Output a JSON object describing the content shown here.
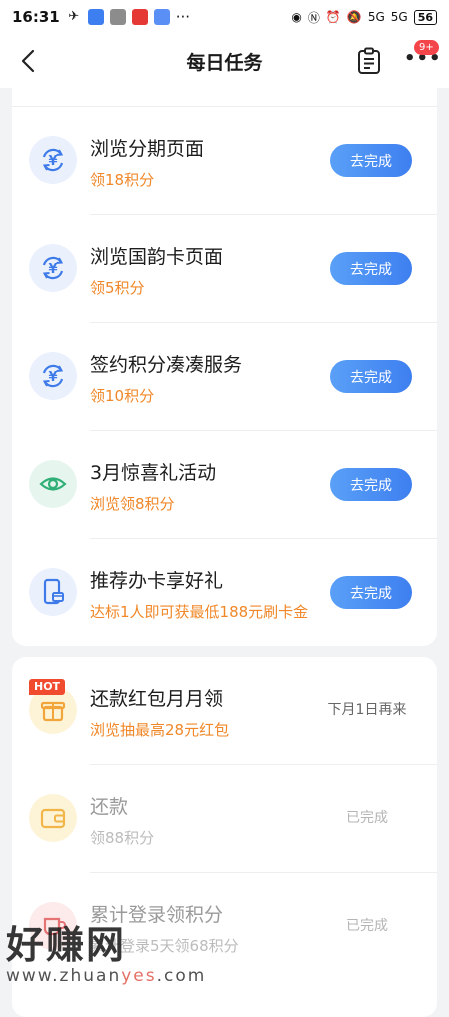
{
  "status_bar": {
    "time": "16:31",
    "app_icons": [
      {
        "name": "wechat-like-icon",
        "color": "#222222"
      },
      {
        "name": "app-blue-icon",
        "color": "#3d7ef0"
      },
      {
        "name": "app-gray-icon",
        "color": "#8c8c8c"
      },
      {
        "name": "app-red-icon",
        "color": "#e53935"
      },
      {
        "name": "app-blue2-icon",
        "color": "#5a8ff5"
      }
    ],
    "more": "···",
    "signal_1": "5G",
    "signal_2": "5G",
    "battery": "56"
  },
  "nav": {
    "title": "每日任务",
    "badge": "9+"
  },
  "tasks_card1": [
    {
      "title": "浏览分期页面",
      "reward": "领18积分",
      "button": "去完成",
      "icon": "yuan-cycle-icon",
      "icon_style": "blue"
    },
    {
      "title": "浏览国韵卡页面",
      "reward": "领5积分",
      "button": "去完成",
      "icon": "yuan-cycle-icon",
      "icon_style": "blue"
    },
    {
      "title": "签约积分凑凑服务",
      "reward": "领10积分",
      "button": "去完成",
      "icon": "yuan-cycle-icon",
      "icon_style": "blue"
    },
    {
      "title": "3月惊喜礼活动",
      "reward": "浏览领8积分",
      "button": "去完成",
      "icon": "eye-icon",
      "icon_style": "green"
    },
    {
      "title": "推荐办卡享好礼",
      "reward": "达标1人即可获最低188元刷卡金",
      "button": "去完成",
      "icon": "phone-card-icon",
      "icon_style": "blue"
    }
  ],
  "tasks_card2": [
    {
      "title": "还款红包月月领",
      "reward": "浏览抽最高28元红包",
      "status": "下月1日再来",
      "tag": "HOT",
      "icon": "gift-icon",
      "icon_style": "yellow"
    },
    {
      "title": "还款",
      "reward": "领88积分",
      "status": "已完成",
      "icon": "wallet-icon",
      "icon_style": "yellow"
    },
    {
      "title": "累计登录领积分",
      "reward": "累计登录5天领68积分",
      "status": "已完成",
      "icon": "cup-icon",
      "icon_style": "red"
    }
  ],
  "watermark": {
    "brand": "好赚网",
    "url_pre": "www.zhuan",
    "url_accent": "yes",
    "url_post": ".com"
  }
}
